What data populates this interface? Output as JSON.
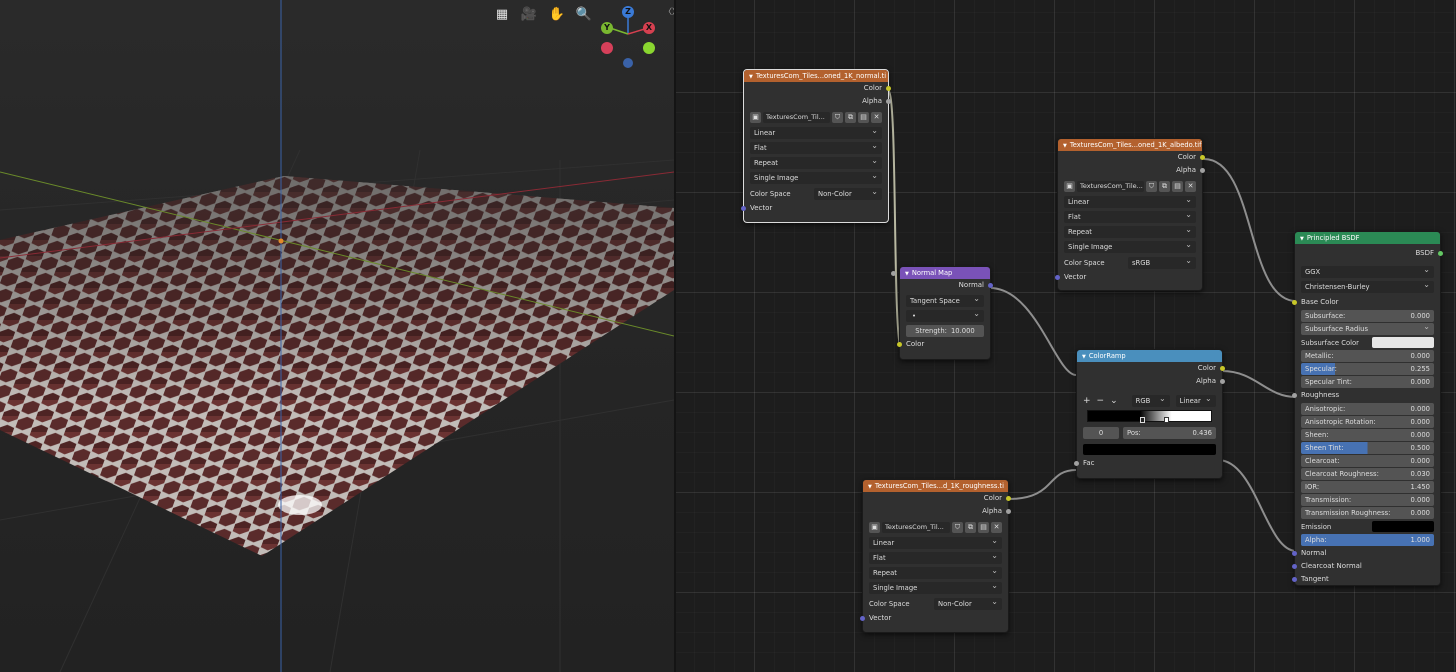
{
  "viewport": {
    "tools": [
      {
        "icon": "grid-icon",
        "glyph": "▦"
      },
      {
        "icon": "camera-icon",
        "glyph": "🎥"
      },
      {
        "icon": "hand-icon",
        "glyph": "✋"
      },
      {
        "icon": "zoom-icon",
        "glyph": "🔍"
      }
    ],
    "gizmo": {
      "z": "Z",
      "y": "Y",
      "x": "X"
    },
    "collapse_glyph": "〈〉"
  },
  "nodes": {
    "normal_tex": {
      "title": "TexturesCom_Tiles...oned_1K_normal.ti",
      "outputs": [
        "Color",
        "Alpha"
      ],
      "image_name": "TexturesCom_Til...",
      "dropdowns": [
        "Linear",
        "Flat",
        "Repeat",
        "Single Image"
      ],
      "color_space_label": "Color Space",
      "color_space": "Non-Color",
      "input": "Vector"
    },
    "albedo_tex": {
      "title": "TexturesCom_Tiles...oned_1K_albedo.tif",
      "outputs": [
        "Color",
        "Alpha"
      ],
      "image_name": "TexturesCom_Tile...",
      "dropdowns": [
        "Linear",
        "Flat",
        "Repeat",
        "Single Image"
      ],
      "color_space_label": "Color Space",
      "color_space": "sRGB",
      "input": "Vector"
    },
    "rough_tex": {
      "title": "TexturesCom_Tiles...d_1K_roughness.ti",
      "outputs": [
        "Color",
        "Alpha"
      ],
      "image_name": "TexturesCom_Til...",
      "dropdowns": [
        "Linear",
        "Flat",
        "Repeat",
        "Single Image"
      ],
      "color_space_label": "Color Space",
      "color_space": "Non-Color",
      "input": "Vector"
    },
    "normal_map": {
      "title": "Normal Map",
      "output": "Normal",
      "space": "Tangent Space",
      "uv": "•",
      "strength_label": "Strength:",
      "strength": "10.000",
      "input": "Color"
    },
    "color_ramp": {
      "title": "ColorRamp",
      "outputs": [
        "Color",
        "Alpha"
      ],
      "btn_add": "+",
      "btn_remove": "−",
      "btn_more": "⌄",
      "mode": "RGB",
      "interp": "Linear",
      "index": "0",
      "pos_label": "Pos:",
      "pos": "0.436",
      "input": "Fac"
    },
    "bsdf": {
      "title": "Principled BSDF",
      "output": "BSDF",
      "distribution": "GGX",
      "subsurface_method": "Christensen-Burley",
      "base_color": "Base Color",
      "subsurface_label": "Subsurface:",
      "subsurface": "0.000",
      "subsurface_radius": "Subsurface Radius",
      "subsurface_color": "Subsurface Color",
      "fields_a": [
        {
          "label": "Metallic:",
          "value": "0.000",
          "fill": 0
        },
        {
          "label": "Specular:",
          "value": "0.255",
          "fill": 0.255
        },
        {
          "label": "Specular Tint:",
          "value": "0.000",
          "fill": 0
        }
      ],
      "roughness": "Roughness",
      "fields_b": [
        {
          "label": "Anisotropic:",
          "value": "0.000",
          "fill": 0
        },
        {
          "label": "Anisotropic Rotation:",
          "value": "0.000",
          "fill": 0
        },
        {
          "label": "Sheen:",
          "value": "0.000",
          "fill": 0
        },
        {
          "label": "Sheen Tint:",
          "value": "0.500",
          "fill": 0.5
        },
        {
          "label": "Clearcoat:",
          "value": "0.000",
          "fill": 0
        },
        {
          "label": "Clearcoat Roughness:",
          "value": "0.030",
          "fill": 0.03
        },
        {
          "label": "IOR:",
          "value": "1.450",
          "fill": 0
        },
        {
          "label": "Transmission:",
          "value": "0.000",
          "fill": 0
        },
        {
          "label": "Transmission Roughness:",
          "value": "0.000",
          "fill": 0
        }
      ],
      "emission": "Emission",
      "alpha_label": "Alpha:",
      "alpha": "1.000",
      "inputs_tail": [
        "Normal",
        "Clearcoat Normal",
        "Tangent"
      ]
    }
  }
}
